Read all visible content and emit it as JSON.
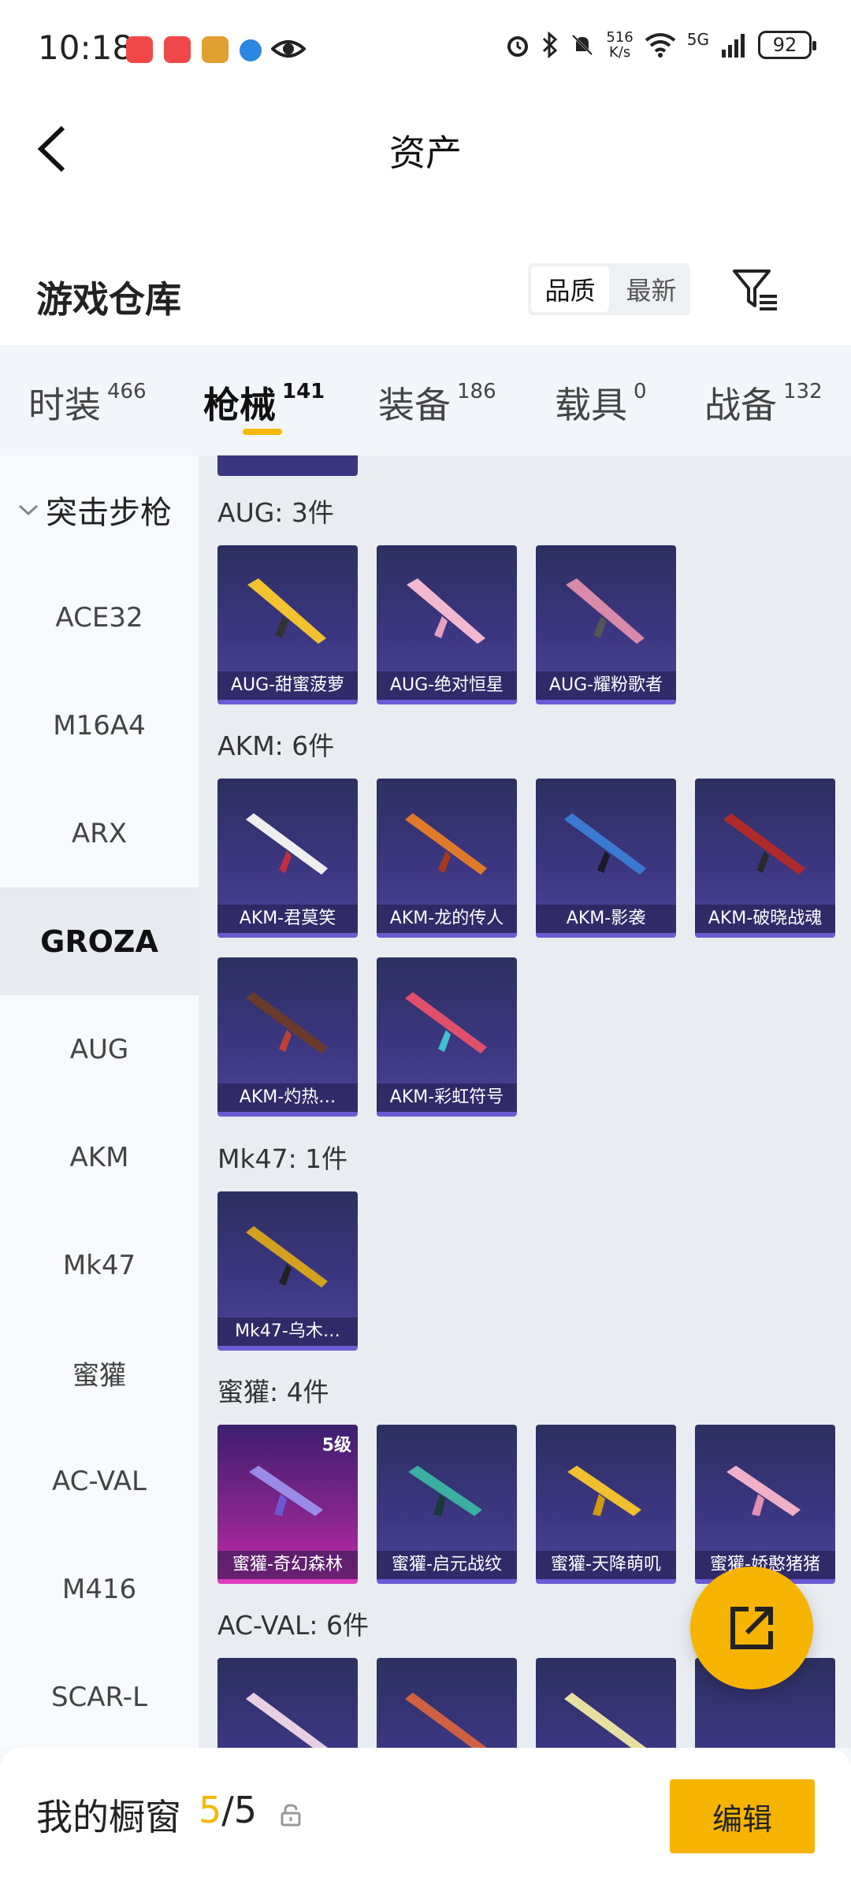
{
  "status_bar": {
    "time": "10:18",
    "net_speed_top": "516",
    "net_speed_bottom": "K/s",
    "network": "5G",
    "battery": "92"
  },
  "header": {
    "title": "资产"
  },
  "warehouse": {
    "title": "游戏仓库",
    "sort_quality": "品质",
    "sort_latest": "最新"
  },
  "tabs": [
    {
      "label": "时装",
      "count": "466"
    },
    {
      "label": "枪械",
      "count": "141"
    },
    {
      "label": "装备",
      "count": "186"
    },
    {
      "label": "载具",
      "count": "0"
    },
    {
      "label": "战备",
      "count": "132"
    }
  ],
  "sidebar": {
    "category": "突击步枪",
    "items": [
      "ACE32",
      "M16A4",
      "ARX",
      "GROZA",
      "AUG",
      "AKM",
      "Mk47",
      "蜜獾",
      "AC-VAL",
      "M416",
      "SCAR-L"
    ]
  },
  "groups": [
    {
      "title": "AUG: 3件",
      "items": [
        {
          "label": "AUG-甜蜜菠萝"
        },
        {
          "label": "AUG-绝对恒星"
        },
        {
          "label": "AUG-耀粉歌者"
        }
      ]
    },
    {
      "title": "AKM: 6件",
      "items": [
        {
          "label": "AKM-君莫笑"
        },
        {
          "label": "AKM-龙的传人"
        },
        {
          "label": "AKM-影袭"
        },
        {
          "label": "AKM-破晓战魂"
        },
        {
          "label": "AKM-灼热…"
        },
        {
          "label": "AKM-彩虹符号"
        }
      ]
    },
    {
      "title": "Mk47: 1件",
      "items": [
        {
          "label": "Mk47-乌木…"
        }
      ]
    },
    {
      "title": "蜜獾: 4件",
      "items": [
        {
          "label": "蜜獾-奇幻森林",
          "level": "5级"
        },
        {
          "label": "蜜獾-启元战纹"
        },
        {
          "label": "蜜獾-天降萌叽"
        },
        {
          "label": "蜜獾-娇憨猪猪"
        }
      ]
    },
    {
      "title": "AC-VAL: 6件"
    }
  ],
  "showcase": {
    "title": "我的橱窗",
    "current": "5",
    "total": "/5",
    "edit_label": "编辑"
  },
  "colors": {
    "accent": "#f6b400",
    "card_bg": "#3b3680",
    "card_purple": "#c42aa8"
  }
}
